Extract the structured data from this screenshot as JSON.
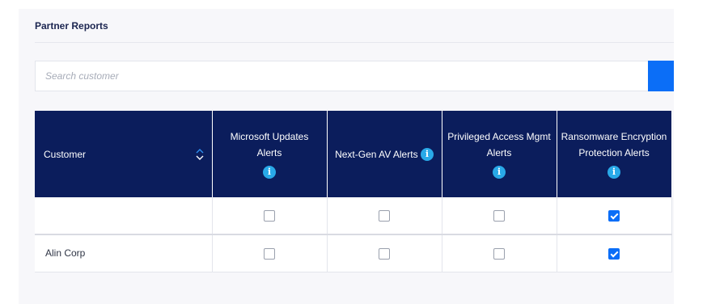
{
  "page": {
    "title": "Partner Reports"
  },
  "search": {
    "placeholder": "Search customer"
  },
  "table": {
    "columns": [
      {
        "label": "Customer",
        "sortable": true,
        "info": false
      },
      {
        "label": "Microsoft Updates Alerts",
        "info": true
      },
      {
        "label": "Next-Gen AV Alerts",
        "info": true
      },
      {
        "label": "Privileged Access Mgmt Alerts",
        "info": true
      },
      {
        "label": "Ransomware Encryption Protection Alerts",
        "info": true
      }
    ],
    "filter_row": {
      "checks": [
        false,
        false,
        false,
        true
      ]
    },
    "rows": [
      {
        "customer": "Alin Corp",
        "checks": [
          false,
          false,
          false,
          true
        ]
      }
    ]
  },
  "icons": {
    "info": "info-icon",
    "sort": "sort-icon",
    "search_button": "search-button"
  },
  "colors": {
    "header_bg": "#0b1d5c",
    "accent_blue": "#0b6ef7",
    "info_blue": "#29a9e8"
  }
}
